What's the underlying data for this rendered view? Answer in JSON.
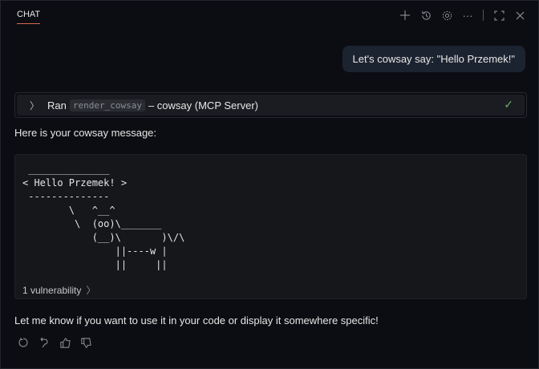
{
  "header": {
    "tab": "CHAT",
    "icons": [
      "plus-icon",
      "history-icon",
      "gear-icon",
      "more-icon",
      "maximize-icon",
      "close-icon"
    ]
  },
  "user_message": "Let's cowsay say: \"Hello Przemek!\"",
  "tool_call": {
    "prefix": "Ran",
    "tool": "render_cowsay",
    "suffix": "– cowsay (MCP Server)",
    "status": "success"
  },
  "response": {
    "intro": "Here is your cowsay message:",
    "art": " ______________\n< Hello Przemek! >\n --------------\n        \\   ^__^\n         \\  (oo)\\_______\n            (__)\\       )\\/\\\n                ||----w |\n                ||     ||",
    "vulnerability": "1 vulnerability",
    "outro": "Let me know if you want to use it in your code or display it somewhere specific!"
  },
  "feedback_icons": [
    "retry-icon",
    "undo-icon",
    "thumbs-up-icon",
    "thumbs-down-icon"
  ]
}
